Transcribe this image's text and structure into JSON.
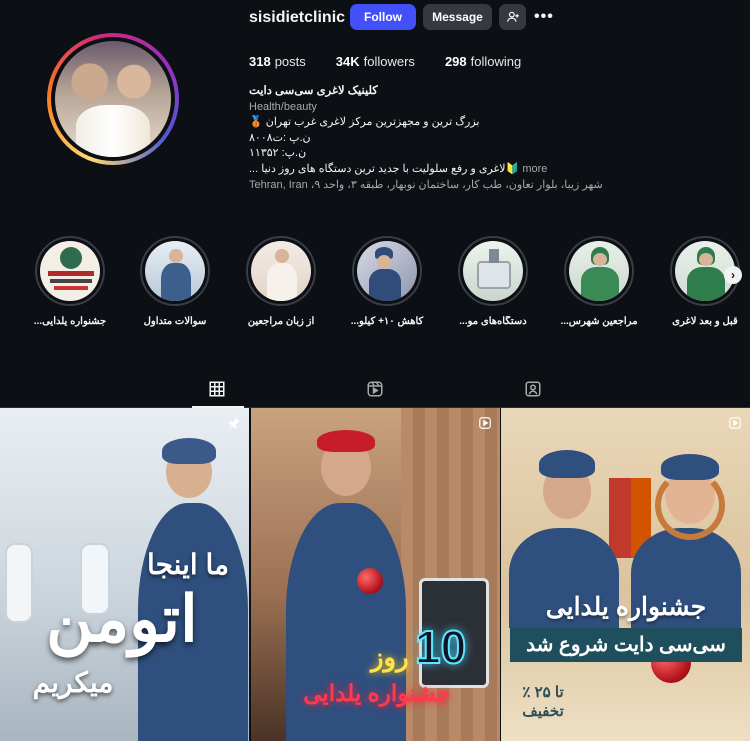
{
  "header": {
    "username": "sisidietclinic",
    "follow_label": "Follow",
    "message_label": "Message",
    "more_icon": "more-dots-icon",
    "stats": {
      "posts_count": "318",
      "posts_label": "posts",
      "followers_count": "34K",
      "followers_label": "followers",
      "following_count": "298",
      "following_label": "following"
    }
  },
  "bio": {
    "name": "کلینیک لاغری سی‌سی دایت",
    "category": "Health/beauty",
    "line1": "بزرگ ترین و مجهزترین مرکز لاغری غرب تهران 🥉",
    "line2": "ن.پ :ت۸۰۰۸",
    "line3": "ن.پ: ۱۱۳۵۲",
    "line4": "🔰لاغری و رفع سلولیت با جدید ترین دستگاه های روز دنیا ...",
    "more": "more",
    "address": "شهر زیبا، بلوار تعاون، طب کار، ساختمان نوبهار، طبقه ۳، واحد ۹، Tehran, Iran"
  },
  "highlights": [
    {
      "label": "جشنواره یلدایی..."
    },
    {
      "label": "سوالات متداول"
    },
    {
      "label": "از زبان مراجعین"
    },
    {
      "label": "کاهش ۱۰+ کیلو..."
    },
    {
      "label": "دستگاه‌های مو..."
    },
    {
      "label": "مراجعین شهرس..."
    },
    {
      "label": "قبل و بعد لاغری"
    }
  ],
  "tabs": {
    "posts_icon": "grid-icon",
    "reels_icon": "reels-icon",
    "tagged_icon": "tagged-icon"
  },
  "posts": [
    {
      "text1": "ما اینجا",
      "text2": "اتومن",
      "text3": "میکریم",
      "badge": "pin-icon"
    },
    {
      "number": "10",
      "roz": "روز",
      "festival": "جشنواره یلدایی",
      "badge": "reel-icon"
    },
    {
      "title": "جشنواره یلدایی",
      "subtitle": "سی‌سی دایت شروع شد",
      "discount_line1": "تا ۲۵ ٪",
      "discount_line2": "تخفیف",
      "badge": "reel-icon"
    }
  ],
  "colors": {
    "background": "#0c0f14",
    "follow_button": "#4150f7",
    "secondary_button": "#363a40"
  }
}
